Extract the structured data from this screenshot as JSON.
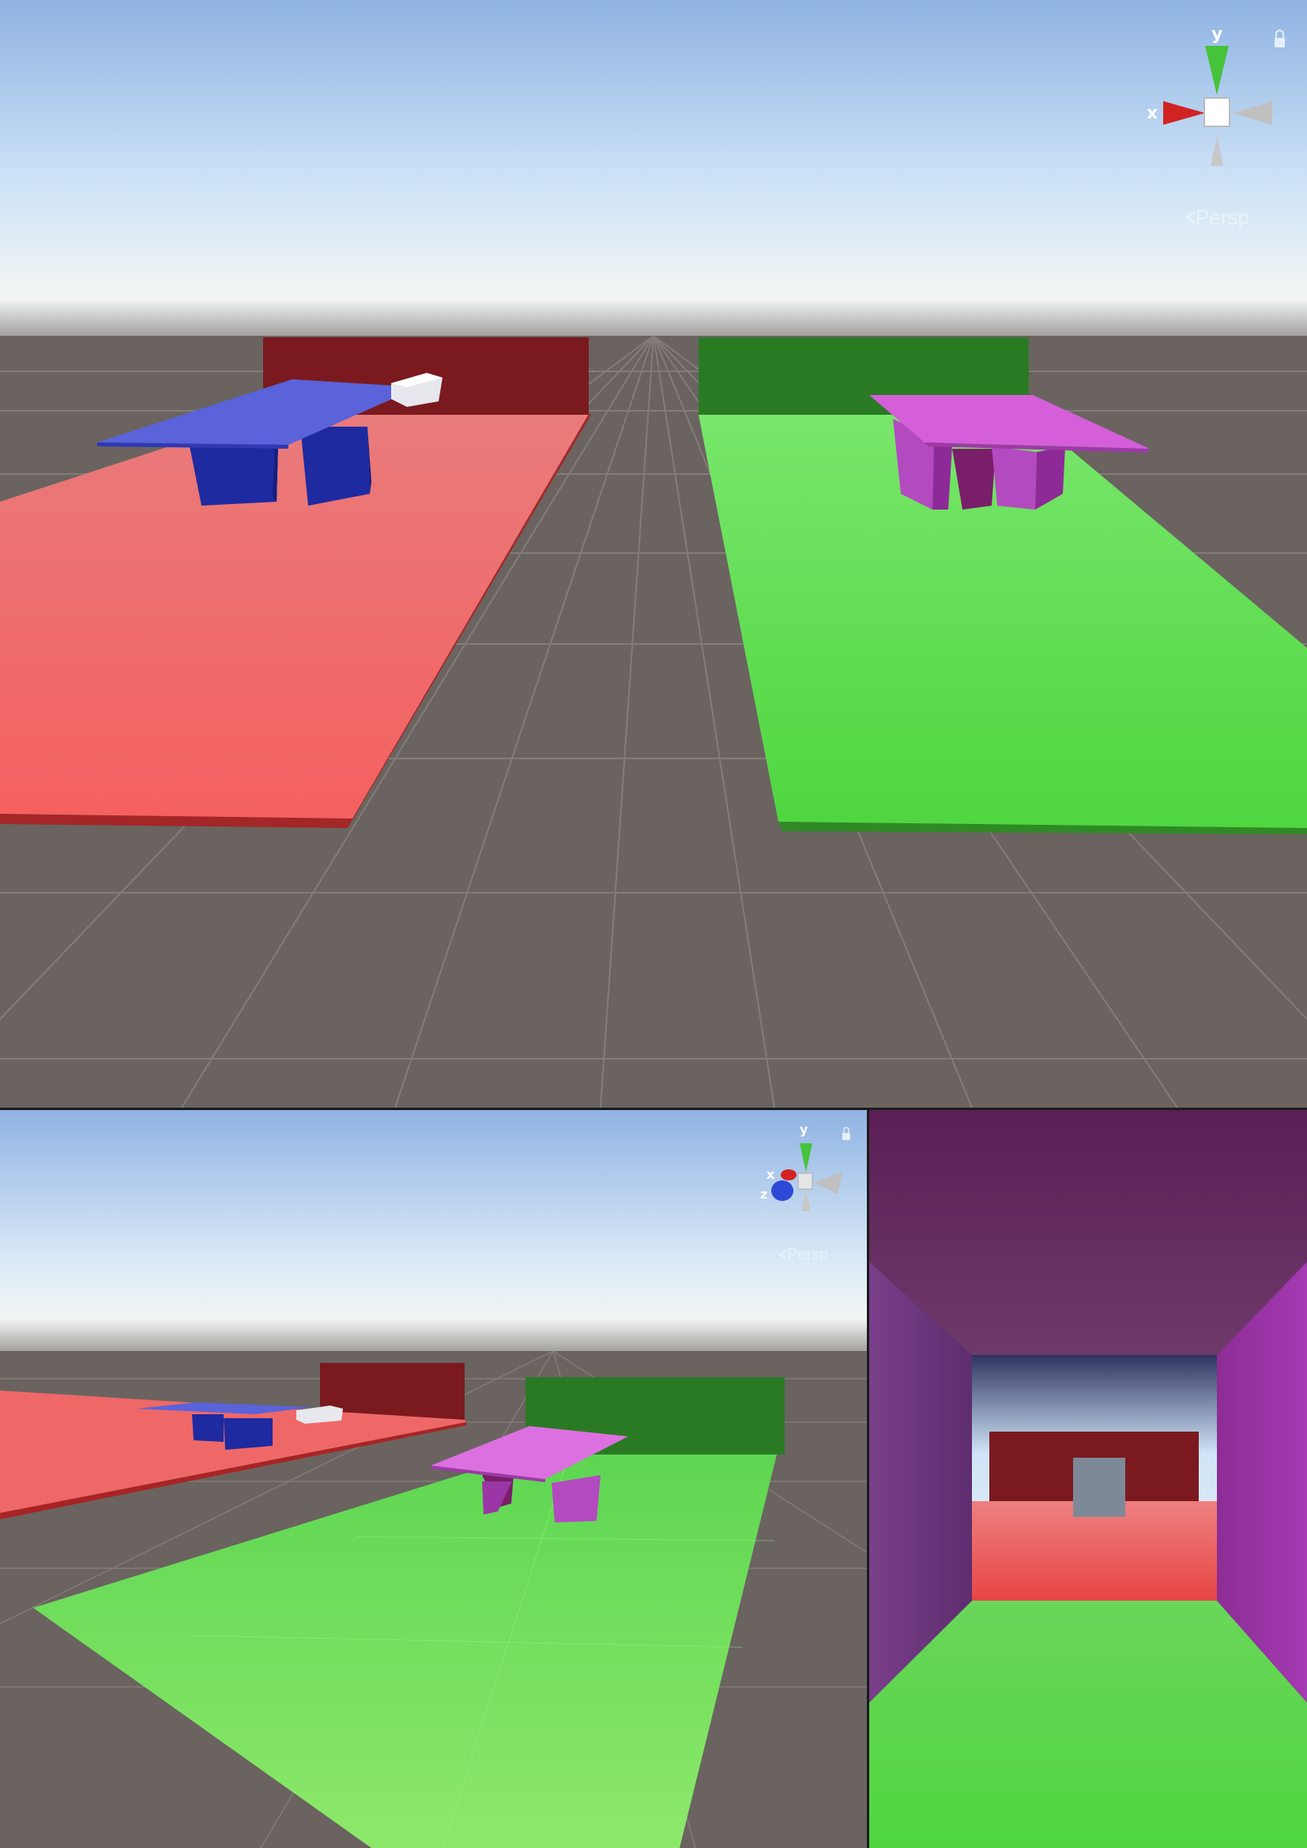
{
  "top_view": {
    "gizmo": {
      "label_y": "y",
      "label_x": "x",
      "icon": "axis-orientation-gizmo"
    },
    "projection_label": "Persp",
    "lock_icon": "lock-icon"
  },
  "bottom_left_view": {
    "gizmo": {
      "label_y": "y",
      "label_x": "x",
      "label_z": "z",
      "icon": "axis-orientation-gizmo"
    },
    "projection_label": "Persp",
    "lock_icon": "lock-icon"
  },
  "bottom_right_view": {
    "camera": "corridor-camera-preview"
  },
  "colors": {
    "red_zone": "#f06767",
    "green_zone": "#57dd4a",
    "blue_table": "#3a45c8",
    "magenta_table": "#d45fd8",
    "ground": "#6a6360",
    "sky_top": "#8fb3e3"
  }
}
